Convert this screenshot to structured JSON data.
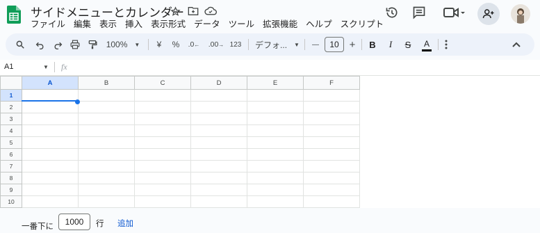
{
  "header": {
    "title": "サイドメニューとカレンダー"
  },
  "menu": [
    "ファイル",
    "編集",
    "表示",
    "挿入",
    "表示形式",
    "データ",
    "ツール",
    "拡張機能",
    "ヘルプ",
    "スクリプト"
  ],
  "toolbar": {
    "zoom": "100%",
    "currency": "¥",
    "percent": "%",
    "decrease_decimal": ".0",
    "increase_decimal": ".00",
    "format_123": "123",
    "font": "デフォ...",
    "minus": "—",
    "font_size": "10",
    "plus": "+",
    "bold": "B",
    "italic": "I",
    "strike": "S",
    "text_color_letter": "A"
  },
  "formula_bar": {
    "cell_ref": "A1",
    "fx": "fx"
  },
  "grid": {
    "columns": [
      "A",
      "B",
      "C",
      "D",
      "E",
      "F"
    ],
    "rows": [
      "1",
      "2",
      "3",
      "4",
      "5",
      "6",
      "7",
      "8",
      "9",
      "10"
    ],
    "selected_cell": "A1"
  },
  "footer": {
    "add_rows_prefix": "一番下に",
    "rows_count": "1000",
    "rows_unit": "行",
    "add_button": "追加"
  },
  "colors": {
    "accent": "#0b57d0",
    "sheets_green": "#0f9d58",
    "toolbar_bg": "#edf2fa"
  }
}
